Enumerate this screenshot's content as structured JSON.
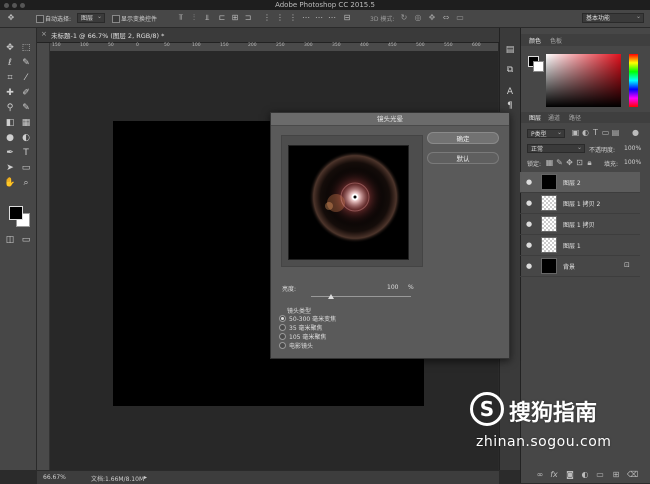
{
  "app": {
    "window_title": "Adobe Photoshop CC 2015.5"
  },
  "options_bar": {
    "auto_select_label": "自动选择:",
    "auto_select_value": "图层",
    "show_transform_label": "显示变换控件",
    "mode_3d_label": "3D 模式:",
    "workspace_value": "基本功能"
  },
  "document": {
    "tab_label": "未标题-1 @ 66.7% (图层 2, RGB/8) *",
    "ruler_ticks": [
      "150",
      "100",
      "50",
      "0",
      "50",
      "100",
      "150",
      "200",
      "250",
      "300",
      "350",
      "400",
      "450",
      "500",
      "550",
      "600"
    ]
  },
  "status": {
    "zoom": "66.67%",
    "doc_info": "文档:1.66M/8.10M"
  },
  "dialog": {
    "title": "镜头光晕",
    "ok_label": "确定",
    "reset_label": "默认",
    "brightness_label": "亮度:",
    "brightness_value": "100",
    "brightness_unit": "%",
    "brightness_fraction": 0.2,
    "lens_type_label": "镜头类型",
    "lens_options": [
      "50-300 毫米变焦",
      "35 毫米聚焦",
      "105 毫米聚焦",
      "电影镜头"
    ],
    "selected_lens_index": 0
  },
  "color_panel": {
    "tabs": [
      "颜色",
      "色板"
    ]
  },
  "layers_panel": {
    "tabs": [
      "图层",
      "通道",
      "路径"
    ],
    "filter_kind": "P类型",
    "blend_mode": "正常",
    "opacity_label": "不透明度:",
    "opacity_value": "100%",
    "lock_label": "锁定:",
    "fill_label": "填充:",
    "fill_value": "100%",
    "layers": [
      {
        "name": "图层 2",
        "thumb": "black",
        "selected": true
      },
      {
        "name": "图层 1 拷贝 2",
        "thumb": "check",
        "selected": false
      },
      {
        "name": "图层 1 拷贝",
        "thumb": "check",
        "selected": false
      },
      {
        "name": "图层 1",
        "thumb": "check",
        "selected": false
      },
      {
        "name": "背景",
        "thumb": "black",
        "selected": false
      }
    ],
    "footer_icons": [
      "link-icon",
      "fx-icon",
      "mask-icon",
      "adjustment-icon",
      "folder-icon",
      "new-layer-icon",
      "trash-icon"
    ]
  },
  "watermark": {
    "logo_glyph": "S",
    "brand": "搜狗指南",
    "url": "zhinan.sogou.com"
  },
  "colors": {
    "foreground": "#000000",
    "background": "#ffffff",
    "accent_red": "#e0101c"
  }
}
